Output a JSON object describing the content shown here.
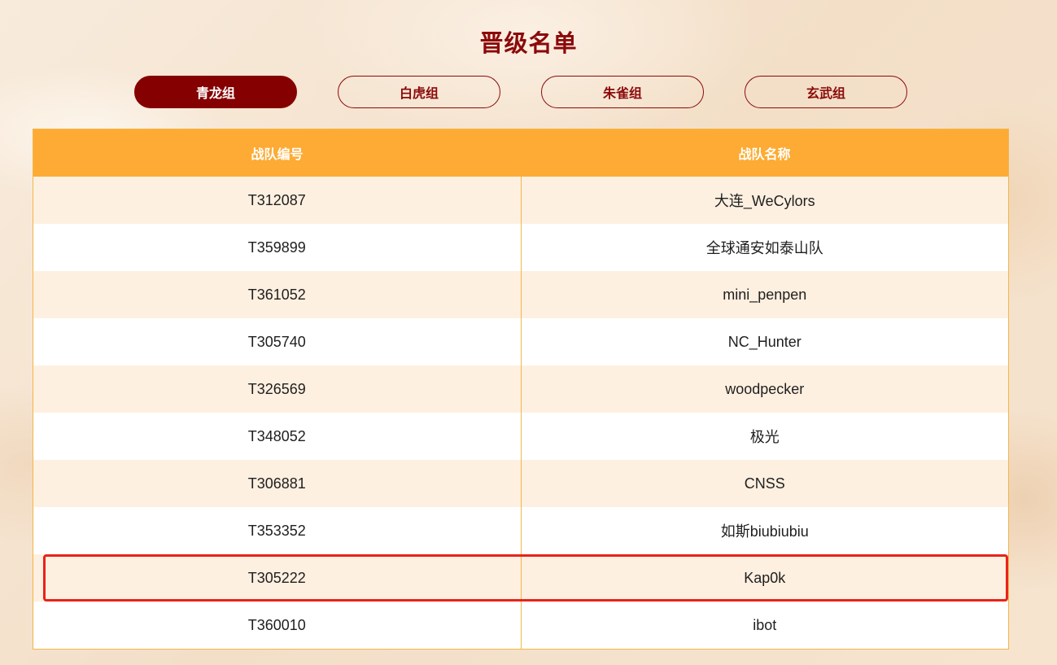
{
  "page": {
    "title": "晋级名单"
  },
  "tabs": [
    {
      "label": "青龙组",
      "active": true
    },
    {
      "label": "白虎组",
      "active": false
    },
    {
      "label": "朱雀组",
      "active": false
    },
    {
      "label": "玄武组",
      "active": false
    }
  ],
  "table": {
    "headers": [
      "战队编号",
      "战队名称"
    ],
    "rows": [
      [
        "T312087",
        "大连_WeCylors"
      ],
      [
        "T359899",
        "全球通安如泰山队"
      ],
      [
        "T361052",
        "mini_penpen"
      ],
      [
        "T305740",
        "NC_Hunter"
      ],
      [
        "T326569",
        "woodpecker"
      ],
      [
        "T348052",
        "极光"
      ],
      [
        "T306881",
        "CNSS"
      ],
      [
        "T353352",
        "如斯biubiubiu"
      ],
      [
        "T305222",
        "Kap0k"
      ],
      [
        "T360010",
        "ibot"
      ]
    ],
    "highlighted_row_index": 8
  },
  "colors": {
    "brand": "#850000",
    "header": "#fdab34",
    "row_alt": "#fef0e0",
    "highlight": "#e8231a"
  }
}
